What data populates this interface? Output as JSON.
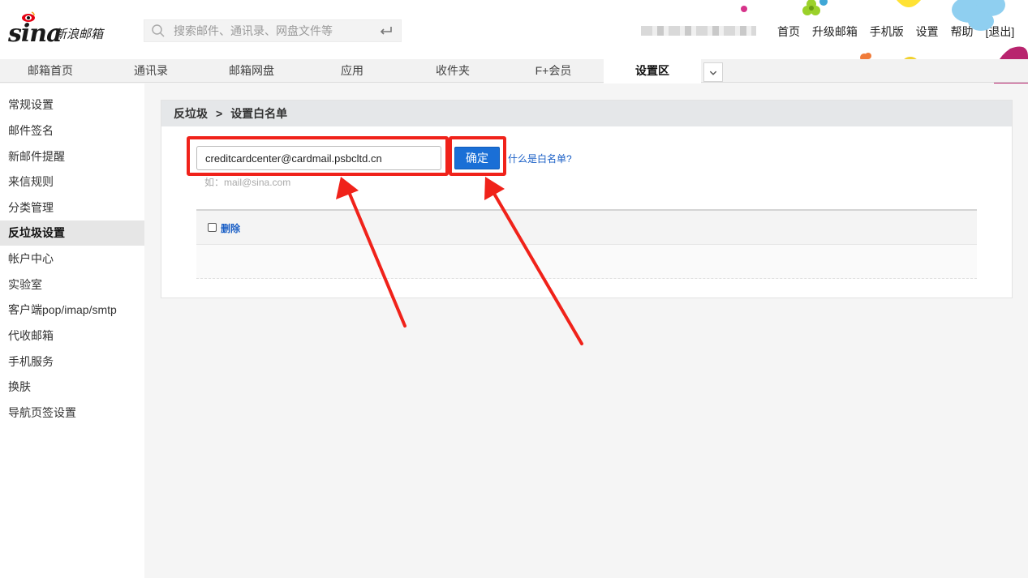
{
  "header": {
    "logo_text": "sina",
    "logo_sub": "新浪邮箱",
    "search_placeholder": "搜索邮件、通讯录、网盘文件等",
    "links": [
      "首页",
      "升级邮箱",
      "手机版",
      "设置",
      "帮助",
      "[退出]"
    ]
  },
  "nav": {
    "tabs": [
      {
        "label": "邮箱首页"
      },
      {
        "label": "通讯录"
      },
      {
        "label": "邮箱网盘"
      },
      {
        "label": "应用"
      },
      {
        "label": "收件夹"
      },
      {
        "label": "F+会员"
      },
      {
        "label": "设置区"
      }
    ],
    "active_index": 6
  },
  "sidebar": {
    "items": [
      {
        "label": "常规设置"
      },
      {
        "label": "邮件签名"
      },
      {
        "label": "新邮件提醒"
      },
      {
        "label": "来信规则"
      },
      {
        "label": "分类管理"
      },
      {
        "label": "反垃圾设置"
      },
      {
        "label": "帐户中心"
      },
      {
        "label": "实验室"
      },
      {
        "label": "客户端pop/imap/smtp"
      },
      {
        "label": "代收邮箱"
      },
      {
        "label": "手机服务"
      },
      {
        "label": "换肤"
      },
      {
        "label": "导航页签设置"
      }
    ],
    "active_index": 5
  },
  "main": {
    "breadcrumb": {
      "parent": "反垃圾",
      "separator": ">",
      "current": "设置白名单"
    },
    "email_value": "creditcardcenter@cardmail.psbcltd.cn",
    "hint": "如：mail@sina.com",
    "confirm_label": "确定",
    "help_link": "什么是白名单?",
    "delete_label": "删除"
  },
  "colors": {
    "annotation": "#f0221a",
    "primary_button": "#1a6fd6",
    "link": "#1a5fc6"
  }
}
